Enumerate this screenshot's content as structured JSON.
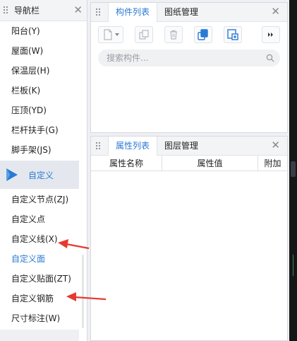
{
  "nav": {
    "title": "导航栏",
    "items_top": [
      "阳台(Y)",
      "屋面(W)",
      "保温层(H)",
      "栏板(K)",
      "压顶(YD)",
      "栏杆扶手(G)",
      "脚手架(JS)"
    ],
    "group_label": "自定义",
    "items_bottom": [
      "自定义节点(ZJ)",
      "自定义点",
      "自定义线(X)",
      "自定义面",
      "自定义贴面(ZT)",
      "自定义钢筋",
      "尺寸标注(W)"
    ],
    "selected_item": "自定义面"
  },
  "panel_components": {
    "tabs": [
      "构件列表",
      "图纸管理"
    ],
    "active_tab": "构件列表",
    "search_placeholder": "搜索构件..."
  },
  "panel_properties": {
    "tabs": [
      "属性列表",
      "图层管理"
    ],
    "active_tab": "属性列表",
    "columns": [
      "属性名称",
      "属性值",
      "附加"
    ]
  },
  "colors": {
    "accent": "#2b79d4",
    "annotation_arrow": "#e63a2e"
  },
  "icons": [
    "grip-icon",
    "close-icon",
    "custom-group-icon",
    "new-file-icon",
    "copy-icon",
    "delete-icon",
    "copy-layer-icon",
    "import-icon",
    "more-icon",
    "search-icon"
  ]
}
